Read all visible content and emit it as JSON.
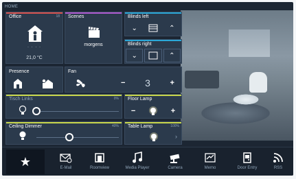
{
  "header": {
    "home_label": "HOME"
  },
  "office": {
    "title": "Office",
    "badge": "18",
    "dots": "· · · ·",
    "temperature": "21,0 °C"
  },
  "scenes": {
    "title": "Scenes",
    "value": "morgens"
  },
  "blinds_left": {
    "title": "Blinds left"
  },
  "blinds_right": {
    "title": "Blinds right"
  },
  "presence": {
    "title": "Presence"
  },
  "fan": {
    "title": "Fan",
    "value": "3",
    "minus": "−",
    "plus": "+"
  },
  "row_dimmer": {
    "title": "Tisch Links",
    "percent": "0%",
    "level": 0
  },
  "floor_lamp": {
    "title": "Floor Lamp",
    "minus": "−",
    "plus": "+"
  },
  "ceiling_dimmer": {
    "title": "Ceiling Dimmer",
    "percent": "40%",
    "level": 0.4
  },
  "table_lamp": {
    "title": "Table Lamp",
    "percent": "100%"
  },
  "dock": {
    "items": [
      {
        "label": "E-Mail",
        "icon": "email-icon"
      },
      {
        "label": "Roomview",
        "icon": "roomview-icon"
      },
      {
        "label": "Media Player",
        "icon": "music-icon"
      },
      {
        "label": "Camera",
        "icon": "camera-icon"
      },
      {
        "label": "Memo",
        "icon": "memo-icon"
      },
      {
        "label": "Door Entry",
        "icon": "door-icon"
      },
      {
        "label": "RSS",
        "icon": "rss-icon"
      }
    ]
  },
  "colors": {
    "office_accent": "#d9534f",
    "scenes_accent": "#b05ad0",
    "blinds_accent": "#2aa8d8",
    "floor_accent": "#c8d64a"
  }
}
